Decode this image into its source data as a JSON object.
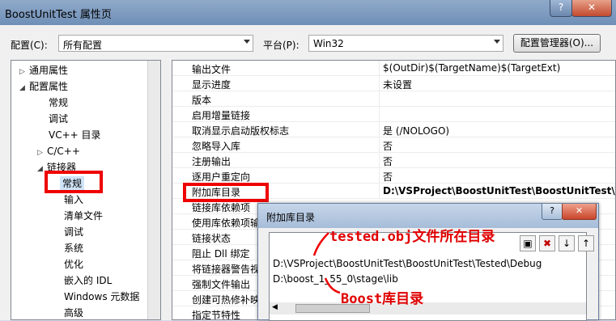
{
  "window": {
    "title": "BoostUnitTest 属性页",
    "help_label": "?",
    "close_label": "✕"
  },
  "toolbar": {
    "config_label": "配置(C):",
    "config_value": "所有配置",
    "platform_label": "平台(P):",
    "platform_value": "Win32",
    "manager_button": "配置管理器(O)..."
  },
  "tree": [
    {
      "label": "通用属性",
      "twisty": "▷"
    },
    {
      "label": "配置属性",
      "twisty": "◢"
    },
    {
      "label": "常规",
      "twisty": ""
    },
    {
      "label": "调试",
      "twisty": ""
    },
    {
      "label": "VC++ 目录",
      "twisty": ""
    },
    {
      "label": "C/C++",
      "twisty": "▷"
    },
    {
      "label": "链接器",
      "twisty": "◢"
    },
    {
      "label": "常规",
      "twisty": ""
    },
    {
      "label": "输入",
      "twisty": ""
    },
    {
      "label": "清单文件",
      "twisty": ""
    },
    {
      "label": "调试",
      "twisty": ""
    },
    {
      "label": "系统",
      "twisty": ""
    },
    {
      "label": "优化",
      "twisty": ""
    },
    {
      "label": "嵌入的 IDL",
      "twisty": ""
    },
    {
      "label": "Windows 元数据",
      "twisty": ""
    },
    {
      "label": "高级",
      "twisty": ""
    }
  ],
  "properties": [
    {
      "name": "输出文件",
      "value": "$(OutDir)$(TargetName)$(TargetExt)"
    },
    {
      "name": "显示进度",
      "value": "未设置"
    },
    {
      "name": "版本",
      "value": ""
    },
    {
      "name": "启用增量链接",
      "value": ""
    },
    {
      "name": "取消显示启动版权标志",
      "value": "是 (/NOLOGO)"
    },
    {
      "name": "忽略导入库",
      "value": "否"
    },
    {
      "name": "注册输出",
      "value": "否"
    },
    {
      "name": "逐用户重定向",
      "value": "否"
    },
    {
      "name": "附加库目录",
      "value": "D:\\VSProject\\BoostUnitTest\\BoostUnitTest\\T"
    },
    {
      "name": "链接库依赖项",
      "value": ""
    },
    {
      "name": "使用库依赖项输",
      "value": ""
    },
    {
      "name": "链接状态",
      "value": ""
    },
    {
      "name": "阻止 Dll 绑定",
      "value": ""
    },
    {
      "name": "将链接器警告视",
      "value": ""
    },
    {
      "name": "强制文件输出",
      "value": ""
    },
    {
      "name": "创建可热修补映",
      "value": ""
    },
    {
      "name": "指定节特性",
      "value": ""
    }
  ],
  "dialog": {
    "title": "附加库目录",
    "help_label": "?",
    "close_label": "✕",
    "paths": [
      "D:\\VSProject\\BoostUnitTest\\BoostUnitTest\\Tested\\Debug",
      "D:\\boost_1_55_0\\stage\\lib"
    ],
    "tools": {
      "new_folder": "▣",
      "delete": "✖",
      "down": "↓",
      "up": "↑"
    },
    "scroll_left": "◀"
  },
  "annotations": {
    "tested": "tested.obj文件所在目录",
    "boost": "Boost库目录"
  },
  "colors": {
    "annotation_red": "#ee0000",
    "selection": "#cfe3f7"
  }
}
